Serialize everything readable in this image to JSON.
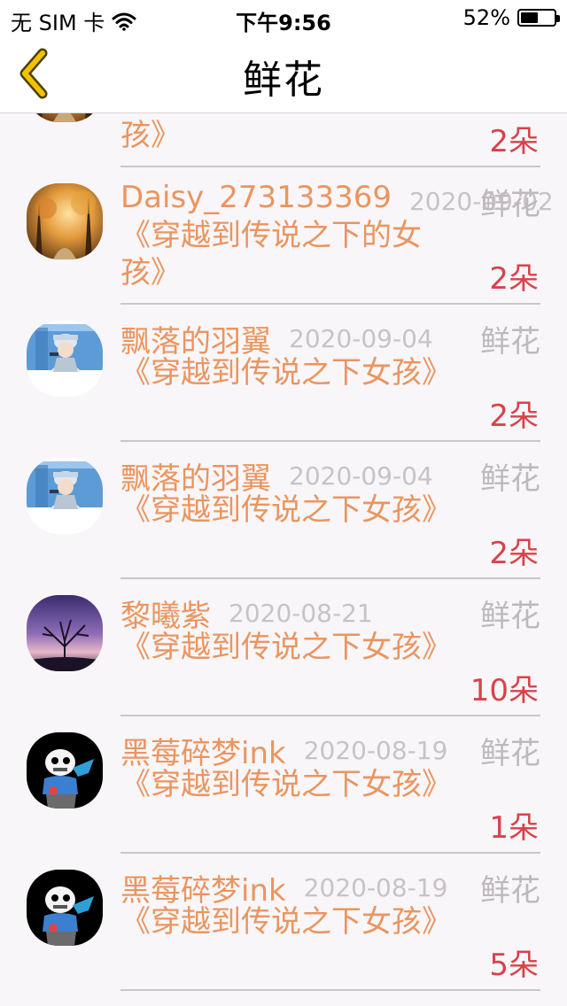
{
  "status_bar": {
    "carrier": "无 SIM 卡",
    "time": "下午9:56",
    "battery": "52%",
    "battery_level": 0.52
  },
  "nav": {
    "title": "鲜花",
    "back_icon": "chevron-left-icon",
    "back_color": "#f2c200"
  },
  "colors": {
    "name": "#ea9560",
    "date": "#c7c3c6",
    "count": "#d8424a"
  },
  "rows": [
    {
      "name": "",
      "date": "",
      "type": "",
      "book": "《穿越到传说之下的女孩》",
      "count": "2朵",
      "avatar": "forest-autumn"
    },
    {
      "name": "Daisy_273133369",
      "date": "2020-09-02",
      "type": "鲜花",
      "book": "《穿越到传说之下的女孩》",
      "count": "2朵",
      "avatar": "forest-autumn"
    },
    {
      "name": "飘落的羽翼",
      "date": "2020-09-04",
      "type": "鲜花",
      "book": "《穿越到传说之下女孩》",
      "count": "2朵",
      "avatar": "anime-boy"
    },
    {
      "name": "飘落的羽翼",
      "date": "2020-09-04",
      "type": "鲜花",
      "book": "《穿越到传说之下女孩》",
      "count": "2朵",
      "avatar": "anime-boy"
    },
    {
      "name": "黎曦紫",
      "date": "2020-08-21",
      "type": "鲜花",
      "book": "《穿越到传说之下女孩》",
      "count": "10朵",
      "avatar": "purple-tree"
    },
    {
      "name": "黑莓碎梦ink",
      "date": "2020-08-19",
      "type": "鲜花",
      "book": "《穿越到传说之下女孩》",
      "count": "1朵",
      "avatar": "skeleton"
    },
    {
      "name": "黑莓碎梦ink",
      "date": "2020-08-19",
      "type": "鲜花",
      "book": "《穿越到传说之下女孩》",
      "count": "5朵",
      "avatar": "skeleton"
    }
  ]
}
